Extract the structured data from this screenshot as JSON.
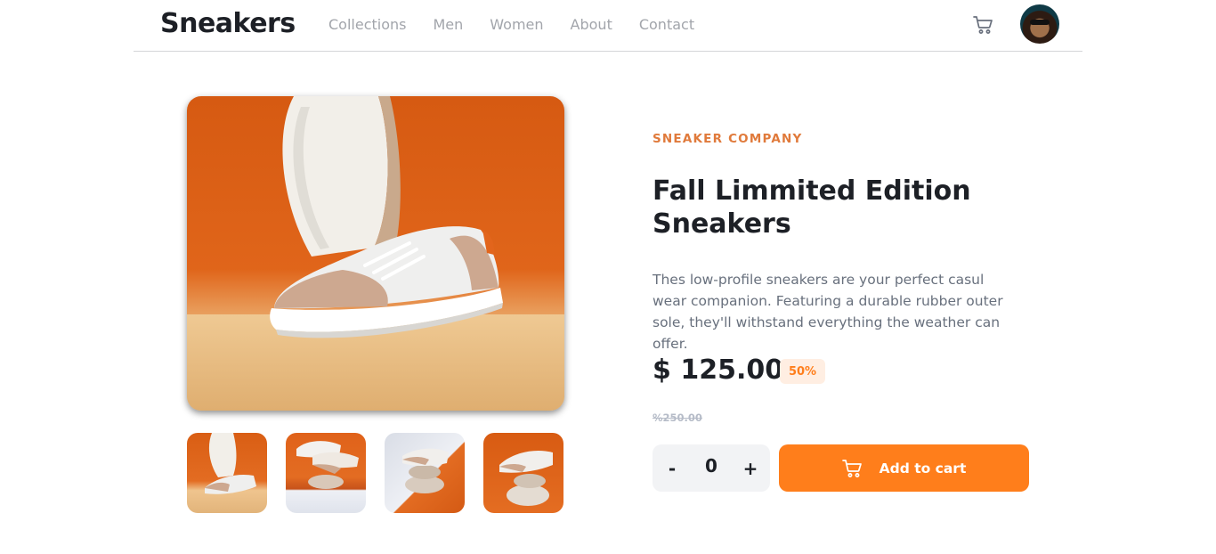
{
  "header": {
    "logo": "Sneakers",
    "nav": [
      "Collections",
      "Men",
      "Women",
      "About",
      "Contact"
    ]
  },
  "product": {
    "company": "SNEAKER COMPANY",
    "title": "Fall Limmited Edition Sneakers",
    "description": "Thes low-profile sneakers are your perfect casul wear companion. Featuring a durable rubber outer sole, they'll withstand everything the weather can offer.",
    "price": "$ 125.00",
    "discount": "50%",
    "old_price": "%250.00"
  },
  "cart_controls": {
    "minus": "-",
    "quantity": "0",
    "plus": "+",
    "add_label": "Add to cart"
  },
  "colors": {
    "accent": "#ff7e1b",
    "accent_pale": "#ffeee2",
    "text_dark": "#1d2026",
    "text_grey": "#68707d"
  },
  "icons": [
    "cart-icon",
    "avatar"
  ]
}
